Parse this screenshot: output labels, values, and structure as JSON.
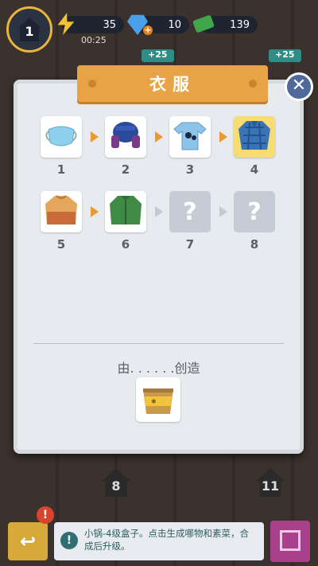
{
  "hud": {
    "level": "1",
    "energy": "35",
    "energy_timer": "00:25",
    "gems": "10",
    "cash": "139",
    "reward_left": "+25",
    "reward_right": "+25"
  },
  "modal": {
    "title": "衣服",
    "created_by": "由. . . . . .创造",
    "items": [
      {
        "label": "1",
        "icon": "face-mask-icon",
        "state": "unlocked"
      },
      {
        "label": "2",
        "icon": "ushanka-hat-icon",
        "state": "unlocked"
      },
      {
        "label": "3",
        "icon": "tshirt-icon",
        "state": "unlocked"
      },
      {
        "label": "4",
        "icon": "plaid-shirt-icon",
        "state": "current"
      },
      {
        "label": "5",
        "icon": "sweater-icon",
        "state": "unlocked"
      },
      {
        "label": "6",
        "icon": "green-jacket-icon",
        "state": "unlocked"
      },
      {
        "label": "7",
        "icon": "question-mark-icon",
        "state": "locked"
      },
      {
        "label": "8",
        "icon": "question-mark-icon",
        "state": "locked"
      }
    ],
    "unknown_glyph": "?",
    "close_glyph": "✕",
    "source_icon": "pot-box-icon"
  },
  "board": {
    "slot_left": "8",
    "slot_right": "11"
  },
  "bottom": {
    "alert_glyph": "!",
    "info_glyph": "!",
    "info_text": "小锅-4级盒子。点击生成哪物和素菜，合成后升级。"
  },
  "colors": {
    "accent_orange": "#e9a347",
    "current_highlight": "#f7dc74",
    "close_blue": "#4f6a9a",
    "info_teal": "#2f6f74"
  }
}
